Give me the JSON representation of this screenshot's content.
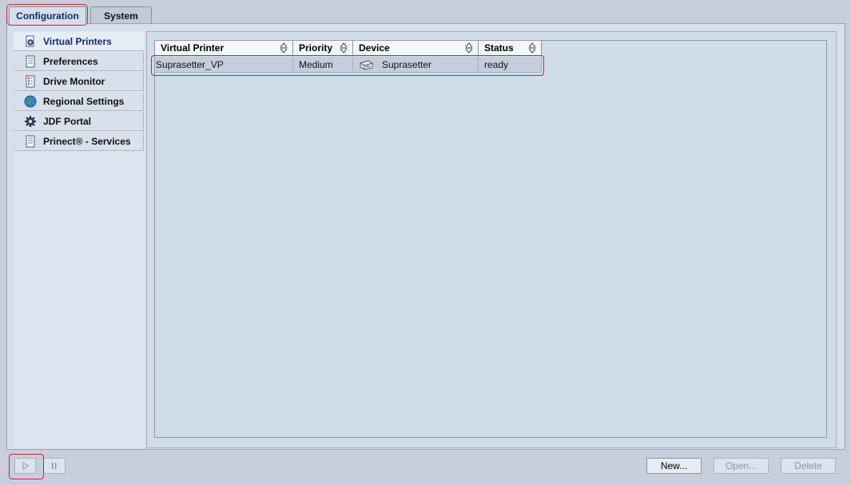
{
  "tabs": [
    {
      "label": "Configuration",
      "active": true
    },
    {
      "label": "System",
      "active": false
    }
  ],
  "sidebar": {
    "items": [
      {
        "label": "Virtual Printers",
        "icon": "gear-printer-icon",
        "selected": true
      },
      {
        "label": "Preferences",
        "icon": "document-icon",
        "selected": false
      },
      {
        "label": "Drive Monitor",
        "icon": "drive-list-icon",
        "selected": false
      },
      {
        "label": "Regional Settings",
        "icon": "globe-icon",
        "selected": false
      },
      {
        "label": "JDF Portal",
        "icon": "cog-icon",
        "selected": false
      },
      {
        "label": "Prinect® - Services",
        "icon": "document-icon",
        "selected": false
      }
    ]
  },
  "table": {
    "columns": [
      "Virtual Printer",
      "Priority",
      "Device",
      "Status"
    ],
    "rows": [
      {
        "virtual_printer": "Suprasetter_VP",
        "priority": "Medium",
        "device": "Suprasetter",
        "device_icon": "printer-icon",
        "status": "ready"
      }
    ]
  },
  "footer": {
    "play_icon": "play-icon",
    "pause_icon": "pause-icon",
    "new_label": "New...",
    "open_label": "Open...",
    "delete_label": "Delete"
  },
  "colors": {
    "highlight": "#d8232a",
    "tab_active_text": "#0f2d6b"
  }
}
